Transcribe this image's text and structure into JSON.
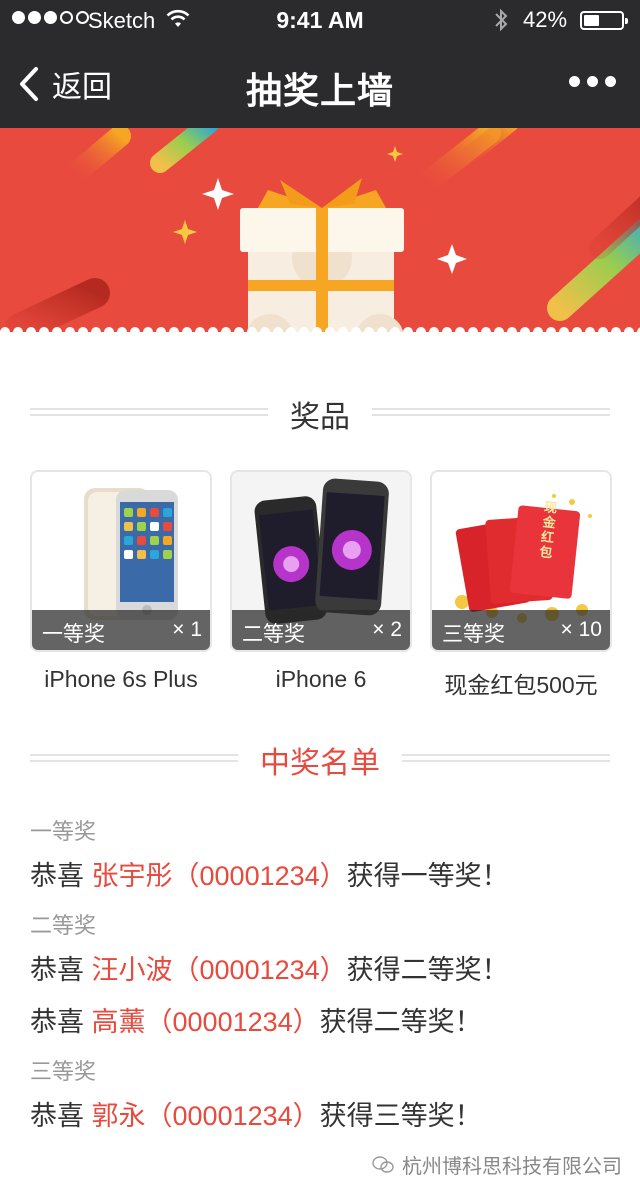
{
  "status": {
    "carrier": "Sketch",
    "time": "9:41 AM",
    "battery_pct": "42%",
    "battery_level": 0.42,
    "signal_bars": 3,
    "signal_total": 5
  },
  "nav": {
    "back_label": "返回",
    "title": "抽奖上墙",
    "more_icon": "more-icon"
  },
  "prizes_section": {
    "title": "奖品"
  },
  "prizes": [
    {
      "tier": "一等奖",
      "qty": "× 1",
      "name": "iPhone 6s Plus",
      "icon": "iphone-gold-image"
    },
    {
      "tier": "二等奖",
      "qty": "× 2",
      "name": "iPhone 6",
      "icon": "iphone-gray-image"
    },
    {
      "tier": "三等奖",
      "qty": "× 10",
      "name": "现金红包500元",
      "icon": "red-envelope-image",
      "envelope_text": "现金红包"
    }
  ],
  "winners_section": {
    "title": "中奖名单"
  },
  "winners": [
    {
      "tier": "一等奖",
      "entries": [
        {
          "prefix": "恭喜 ",
          "name": "张宇彤（00001234）",
          "suffix": "获得一等奖！"
        }
      ]
    },
    {
      "tier": "二等奖",
      "entries": [
        {
          "prefix": "恭喜 ",
          "name": "汪小波（00001234）",
          "suffix": "获得二等奖！"
        },
        {
          "prefix": "恭喜 ",
          "name": "高薰（00001234）",
          "suffix": "获得二等奖！"
        }
      ]
    },
    {
      "tier": "三等奖",
      "entries": [
        {
          "prefix": "恭喜 ",
          "name": "郭永（00001234）",
          "suffix": "获得三等奖！"
        }
      ]
    }
  ],
  "watermark": "杭州博科思科技有限公司",
  "colors": {
    "accent": "#e84a3e",
    "nav_bg": "#2b2b2d",
    "muted_text": "#999999"
  }
}
